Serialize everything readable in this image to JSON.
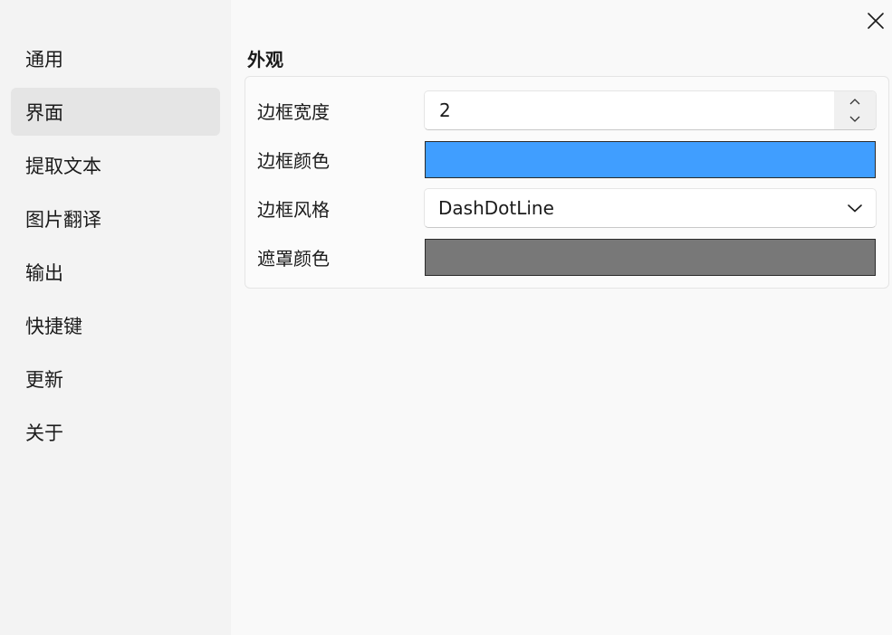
{
  "sidebar": {
    "items": [
      {
        "label": "通用"
      },
      {
        "label": "界面"
      },
      {
        "label": "提取文本"
      },
      {
        "label": "图片翻译"
      },
      {
        "label": "输出"
      },
      {
        "label": "快捷键"
      },
      {
        "label": "更新"
      },
      {
        "label": "关于"
      }
    ],
    "active_index": 1
  },
  "main": {
    "section_title": "外观",
    "border_width": {
      "label": "边框宽度",
      "value": "2"
    },
    "border_color": {
      "label": "边框颜色",
      "color": "#409eff"
    },
    "border_style": {
      "label": "边框风格",
      "value": "DashDotLine"
    },
    "mask_color": {
      "label": "遮罩颜色",
      "color": "#787878"
    }
  },
  "icons": {
    "close": "close-icon",
    "spin_up": "chevron-up-icon",
    "spin_down": "chevron-down-icon",
    "combo": "chevron-down-icon"
  }
}
